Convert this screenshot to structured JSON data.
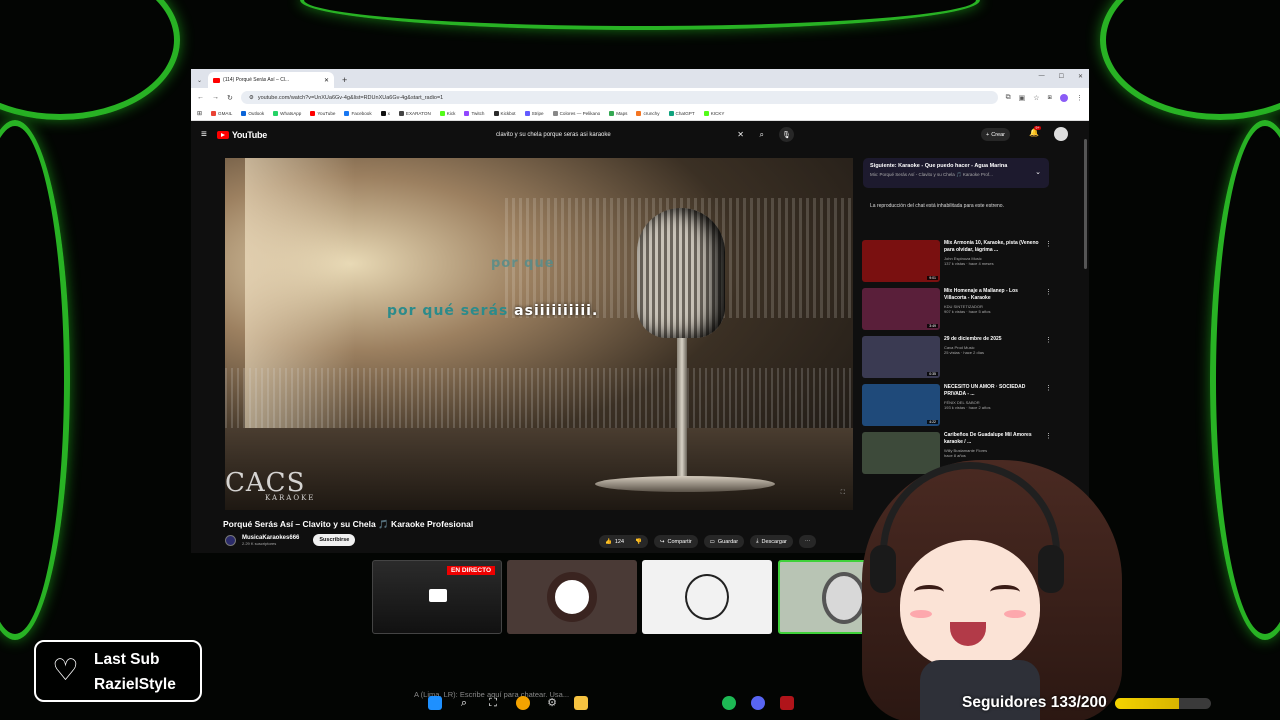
{
  "browser": {
    "tab_title": "(114) Porqué Serás Así – Cl...",
    "url": "youtube.com/watch?v=UnXUa6Gv-4g&list=RDUnXUa6Gv-4g&start_radio=1",
    "bookmarks": [
      {
        "label": "GMAIL",
        "color": "#ea4335"
      },
      {
        "label": "Outlook",
        "color": "#0a64d8"
      },
      {
        "label": "WhatsApp",
        "color": "#25d366"
      },
      {
        "label": "YouTube",
        "color": "#ff0000"
      },
      {
        "label": "Facebook",
        "color": "#1877f2"
      },
      {
        "label": "x",
        "color": "#111111"
      },
      {
        "label": "EXARATON",
        "color": "#444444"
      },
      {
        "label": "Kick",
        "color": "#53fc18"
      },
      {
        "label": "Twitch",
        "color": "#9146ff"
      },
      {
        "label": "Kickbot",
        "color": "#2b2b2b"
      },
      {
        "label": "Stripe",
        "color": "#635bff"
      },
      {
        "label": "Colores — Pelikano",
        "color": "#888888"
      },
      {
        "label": "Maps",
        "color": "#34a853"
      },
      {
        "label": "crunchy",
        "color": "#f47521"
      },
      {
        "label": "ChatGPT",
        "color": "#10a37f"
      },
      {
        "label": "KICKY",
        "color": "#53fc18"
      }
    ]
  },
  "youtube": {
    "logo_text": "YouTube",
    "search_query": "clavito y su chela porque seras asi karaoke",
    "create_label": "Crear",
    "notif_count": "9+",
    "video": {
      "lyric_line1": "por que",
      "lyric_line2_pending": "por qué serás ",
      "lyric_line2_sung": "asiiiiiiiiii.",
      "watermark": "CACS",
      "watermark_sub": "KARAOKE",
      "title": "Porqué Serás Así – Clavito y su Chela 🎵 Karaoke Profesional",
      "channel": "MusicaKaraokes666",
      "subscribers": "2.29 K suscriptores",
      "subscribe_label": "Suscribirse",
      "likes": "124",
      "share_label": "Compartir",
      "save_label": "Guardar",
      "download_label": "Descargar"
    },
    "up_next": {
      "title": "Siguiente: Karaoke - Que puedo hacer - Agua Marina",
      "subtitle": "Mix: Porqué Serás Así - Clavito y su Chela 🎵 Karaoke Prof..."
    },
    "chat_disabled": "La reproducción del chat está inhabilitada para este estreno.",
    "recommendations": [
      {
        "title": "Mix Armonía 10, Karaoke, pista (Veneno para olvidar, lágrima ...",
        "channel": "John Espinoza Music",
        "meta": "137 k vistas · hace 4 meses",
        "duration": "9:01",
        "thumb_color": "#7a1010"
      },
      {
        "title": "Mix Homenaje a Mallanep - Los Villacorta - Karaoke",
        "channel": "KDU SINTETIZADOR",
        "meta": "907 k vistas · hace 5 años",
        "duration": "3:49",
        "thumb_color": "#5a1f3a"
      },
      {
        "title": "29 de diciembre de 2025",
        "channel": "Cava Prod Music",
        "meta": "25 vistas · hace 2 días",
        "duration": "0:35",
        "thumb_color": "#3a3a52"
      },
      {
        "title": "NECESITO UN AMOR · SOCIEDAD PRIVADA - ...",
        "channel": "FÉNIX DEL SABOR",
        "meta": "193 k vistas · hace 2 años",
        "duration": "4:22",
        "thumb_color": "#1f4a7a"
      },
      {
        "title": "Caribeños De Guadalupe  Mil Amores  karaoke / ...",
        "channel": "Willy Bustamante Flores",
        "meta": "hace 8 años",
        "duration": "",
        "thumb_color": "#3d4a3a"
      }
    ]
  },
  "overlay": {
    "live_badge": "EN DIRECTO",
    "last_sub_title": "Last Sub",
    "last_sub_name": "RazielStyle",
    "followers_label": "Seguidores 133/200",
    "followers_progress": 0.665,
    "chat_hint": "A (Lima, LR): Escribe aquí para chatear. Usa..."
  },
  "colors": {
    "frame_green": "#2fd12a",
    "yt_red": "#ff0000",
    "progress_yellow": "#f4d300"
  }
}
